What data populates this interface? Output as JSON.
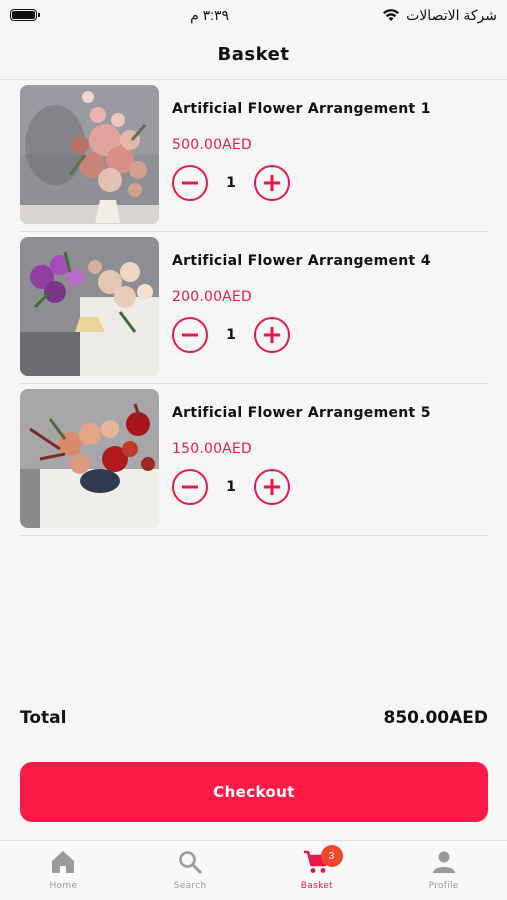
{
  "status_bar": {
    "carrier": "شركة الاتصالات",
    "time": "٣:٣٩ م"
  },
  "header": {
    "title": "Basket"
  },
  "items": [
    {
      "name": "Artificial Flower Arrangement 1",
      "price": "500.00AED",
      "quantity": "1"
    },
    {
      "name": "Artificial Flower Arrangement 4",
      "price": "200.00AED",
      "quantity": "1"
    },
    {
      "name": "Artificial Flower Arrangement 5",
      "price": "150.00AED",
      "quantity": "1"
    }
  ],
  "summary": {
    "total_label": "Total",
    "total_value": "850.00AED"
  },
  "checkout": {
    "label": "Checkout"
  },
  "tabbar": {
    "tabs": [
      {
        "label": "Home",
        "icon": "home-icon"
      },
      {
        "label": "Search",
        "icon": "search-icon"
      },
      {
        "label": "Basket",
        "icon": "cart-icon",
        "badge": "3"
      },
      {
        "label": "Profile",
        "icon": "person-icon"
      }
    ]
  },
  "colors": {
    "accent": "#fd1a48",
    "price": "#e8194a",
    "badge": "#f0462f"
  }
}
